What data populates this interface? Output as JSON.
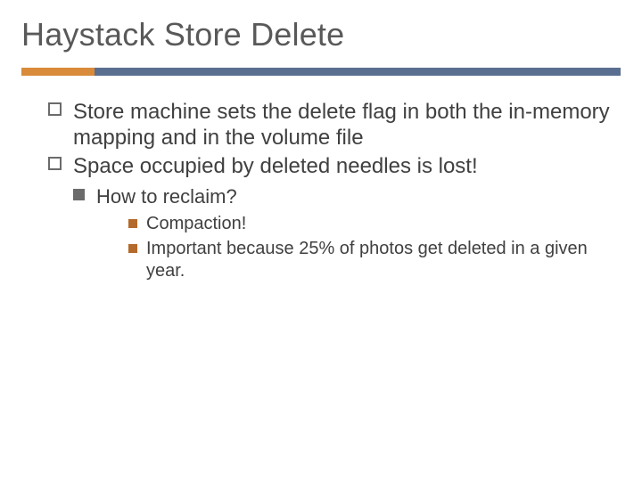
{
  "title": "Haystack Store Delete",
  "bullets": {
    "b1": "Store machine sets the delete flag in both the in-memory mapping and in the volume file",
    "b2": "Space occupied by deleted needles is lost!",
    "b2_sub": "How to reclaim?",
    "b2_sub_items": {
      "i1": "Compaction!",
      "i2": "Important because 25% of photos get deleted in a given year."
    }
  }
}
